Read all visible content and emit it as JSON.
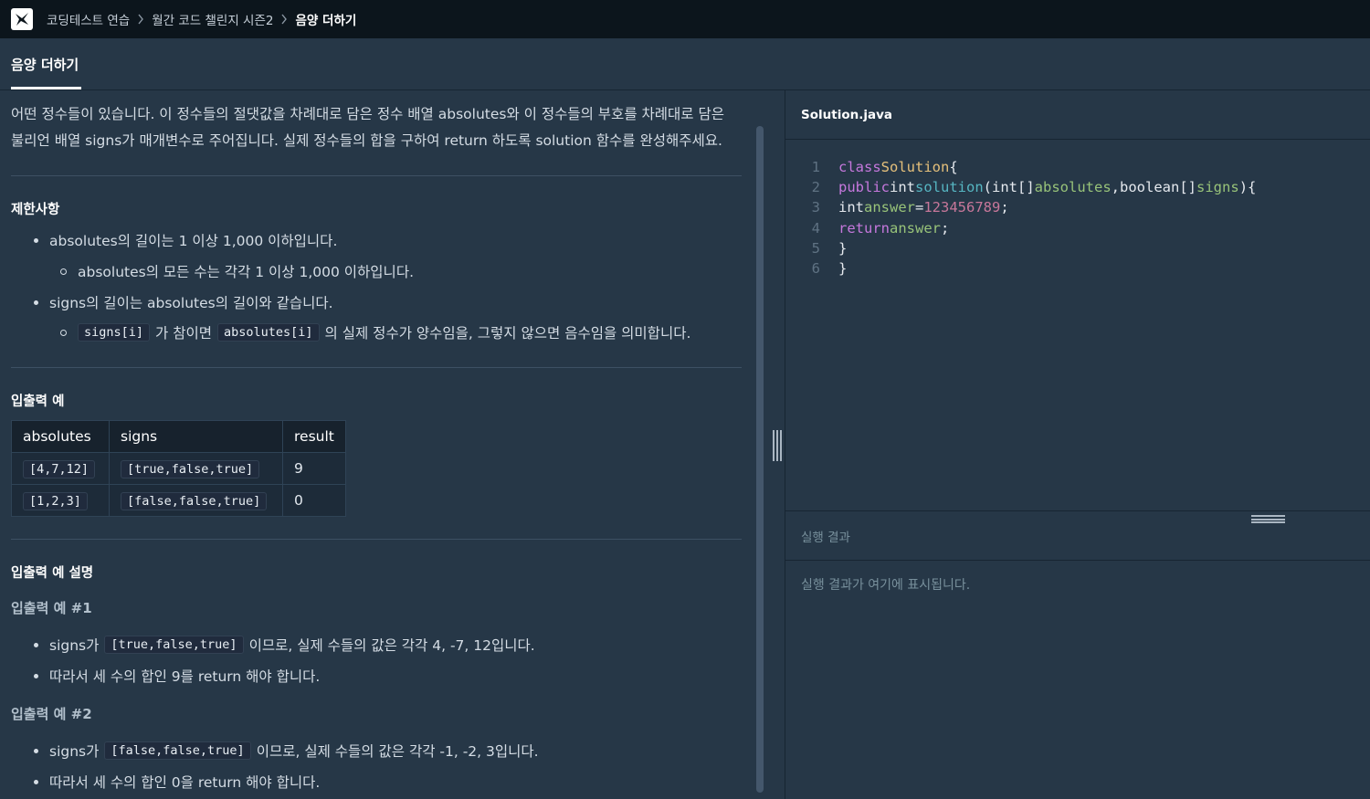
{
  "breadcrumb": [
    "코딩테스트 연습",
    "월간 코드 챌린지 시즌2",
    "음양 더하기"
  ],
  "tab": "음양 더하기",
  "description": [
    "어떤 정수들이 있습니다. 이 정수들의 절댓값을 차례대로 담은 정수 배열 absolutes와 이 정수들의 부호를 차례대로 담은",
    "불리언 배열 signs가 매개변수로 주어집니다. 실제 정수들의 합을 구하여 return 하도록 solution 함수를 완성해주세요."
  ],
  "constraints": {
    "heading": "제한사항",
    "item1": "absolutes의 길이는 1 이상 1,000 이하입니다.",
    "item1_sub": "absolutes의 모든 수는 각각 1 이상 1,000 이하입니다.",
    "item2": "signs의 길이는 absolutes의 길이와 같습니다.",
    "item2_sub": {
      "code1": "signs[i]",
      "mid": "가 참이면",
      "code2": "absolutes[i]",
      "tail": "의 실제 정수가 양수임을, 그렇지 않으면 음수임을 의미합니다."
    }
  },
  "io_example": {
    "heading": "입출력 예",
    "headers": [
      "absolutes",
      "signs",
      "result"
    ],
    "rows": [
      [
        "[4,7,12]",
        "[true,false,true]",
        "9"
      ],
      [
        "[1,2,3]",
        "[false,false,true]",
        "0"
      ]
    ]
  },
  "explanation": {
    "heading": "입출력 예 설명",
    "ex1": {
      "title": "입출력 예 #1",
      "prefix": "signs가",
      "code": "[true,false,true]",
      "suffix": "이므로, 실제 수들의 값은 각각 4, -7, 12입니다.",
      "line2": "따라서 세 수의 합인 9를 return 해야 합니다."
    },
    "ex2": {
      "title": "입출력 예 #2",
      "prefix": "signs가",
      "code": "[false,false,true]",
      "suffix": "이므로, 실제 수들의 값은 각각 -1, -2, 3입니다.",
      "line2": "따라서 세 수의 합인 0을 return 해야 합니다."
    }
  },
  "editor": {
    "filename": "Solution.java",
    "line_numbers": [
      "1",
      "2",
      "3",
      "4",
      "5",
      "6"
    ],
    "tokens": {
      "class_kw": "class",
      "class_name": "Solution",
      "brace_open": "{",
      "public_kw": "public",
      "int_kw": "int",
      "method": "solution",
      "int_arr": "int[]",
      "param1": "absolutes",
      "comma": ",",
      "bool_arr": "boolean[]",
      "param2": "signs",
      "paren_close": ")",
      "answer_var": "answer",
      "equals": "=",
      "number": "123456789",
      "semicolon": ";",
      "return_kw": "return",
      "brace_close": "}"
    }
  },
  "result": {
    "title": "실행 결과",
    "placeholder": "실행 결과가 여기에 표시됩니다."
  },
  "colors": {
    "background": "#263747",
    "topbar": "#0c151c",
    "text": "#d5dde5",
    "muted": "#78909c"
  }
}
